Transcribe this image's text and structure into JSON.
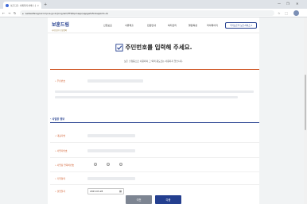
{
  "browser": {
    "tab_title": "보훈드림 - 사회복지 서비스 신청",
    "tab_close": "×",
    "new_tab": "+",
    "win_minimize": "—",
    "win_maximize": "❐",
    "win_close": "✕",
    "nav_back": "←",
    "nav_forward": "→",
    "nav_reload": "↻",
    "url": "wetwelfaregovkr.mpva.go.kr/program/PTR/bpmapp/appgwtsfindappInfo.do"
  },
  "site": {
    "logo_main": "보훈드림",
    "logo_sub": "국가보훈부 보훈정책",
    "nav_items": [
      "신청보훈",
      "서류제출",
      "민원안내",
      "복지관리",
      "혈원육성",
      "마이페이지"
    ],
    "register_button": "국가보훈부 보훈서비스 ▾"
  },
  "form": {
    "heading": "주민번호를 입력해 주세요.",
    "description": "보훈 신청등으로 사용되며 그 외의 용도로는 사용되지 않습니다.",
    "resident_number_label": "주민번호",
    "section_title": "사업장 정보",
    "fields": [
      {
        "label": "대표자명"
      },
      {
        "label": "사업자번호"
      },
      {
        "label": "사업장 연락처번호"
      },
      {
        "label": "기업형태"
      },
      {
        "label": "설립일자"
      }
    ],
    "date_value": "2023-03-28",
    "calendar_icon": "▦",
    "prev_button": "이전",
    "next_button": "다음"
  },
  "colors": {
    "brand_navy": "#243f8f",
    "accent_orange": "#d05a2a",
    "prev_gray": "#7d8592"
  }
}
